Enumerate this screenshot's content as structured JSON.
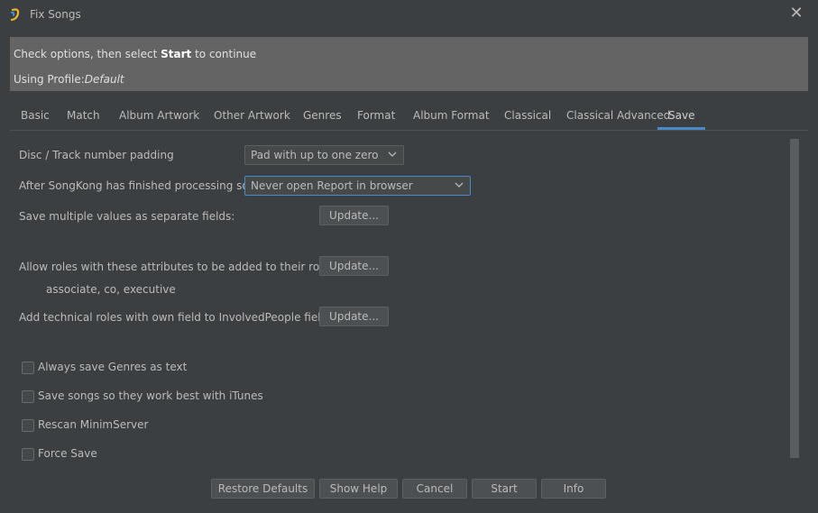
{
  "window": {
    "title": "Fix Songs",
    "close_glyph": "✕"
  },
  "info": {
    "line1_prefix": "Check options, then select ",
    "line1_bold": "Start",
    "line1_suffix": " to continue",
    "line2_prefix": "Using Profile:",
    "line2_profile": "Default"
  },
  "tabs": [
    {
      "label": "Basic"
    },
    {
      "label": "Match"
    },
    {
      "label": "Album Artwork"
    },
    {
      "label": "Other Artwork"
    },
    {
      "label": "Genres"
    },
    {
      "label": "Format"
    },
    {
      "label": "Album Format"
    },
    {
      "label": "Classical"
    },
    {
      "label": "Classical Advanced"
    },
    {
      "label": "Save"
    }
  ],
  "active_tab": "Save",
  "form": {
    "padding_label": "Disc / Track number padding",
    "padding_value": "Pad with up to one zero",
    "after_label": "After SongKong has finished processing songs",
    "after_value": "Never open Report in browser",
    "multi_label": "Save multiple values as separate fields:",
    "roles_label": "Allow roles with these attributes to be added to their role field:",
    "roles_value": "associate, co, executive",
    "technical_label": "Add technical roles with own field to InvolvedPeople field:",
    "update_label": "Update..."
  },
  "checkboxes": [
    {
      "label": "Always save Genres as text",
      "checked": false
    },
    {
      "label": "Save songs so they work best with iTunes",
      "checked": false
    },
    {
      "label": "Rescan MinimServer",
      "checked": false
    },
    {
      "label": "Force Save",
      "checked": false
    }
  ],
  "buttons": {
    "restore": "Restore Defaults",
    "help": "Show Help",
    "cancel": "Cancel",
    "start": "Start",
    "info": "Info"
  },
  "colors": {
    "accent": "#4a88c7",
    "background": "#3c3f41",
    "info_panel": "#646464"
  },
  "icons": {
    "app": "songkong-app-icon",
    "close": "close-icon",
    "dropdown": "chevron-down-icon"
  }
}
